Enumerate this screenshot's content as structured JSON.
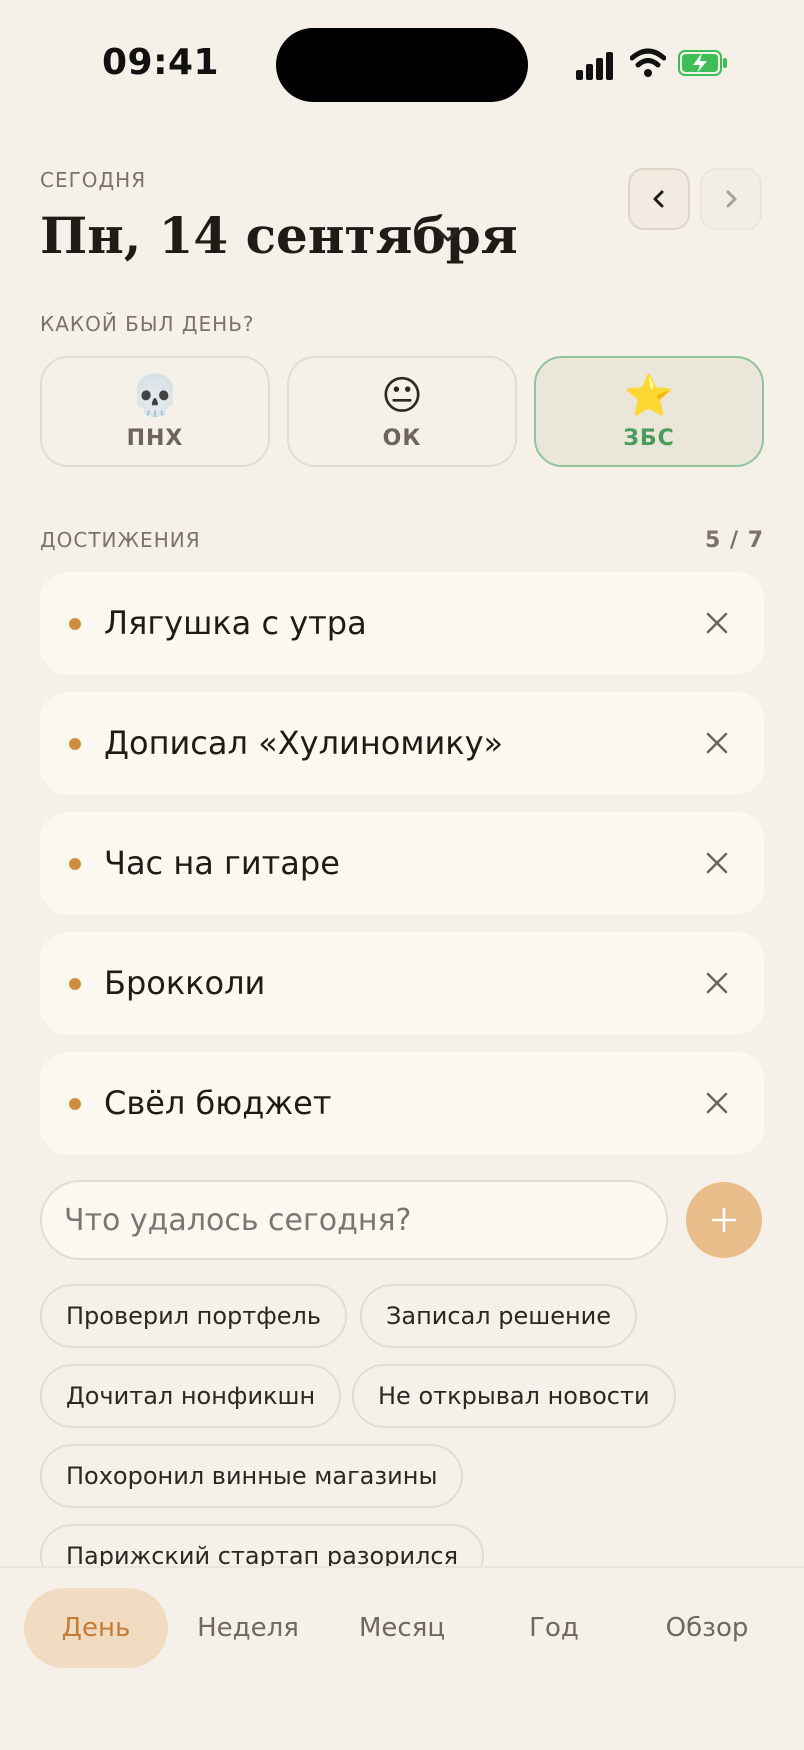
{
  "status": {
    "time": "09:41"
  },
  "header": {
    "today_label": "СЕГОДНЯ",
    "date": "Пн, 14 сентября"
  },
  "mood": {
    "question": "КАКОЙ БЫЛ ДЕНЬ?",
    "options": [
      {
        "emoji": "💀",
        "label": "ПНХ"
      },
      {
        "emoji": "😐",
        "label": "ОК"
      },
      {
        "emoji": "⭐",
        "label": "ЗБС"
      }
    ],
    "selected": "ЗБС",
    "accent": "#4a9c5d"
  },
  "achievements": {
    "label": "ДОСТИЖЕНИЯ",
    "count": "5 / 7",
    "items": [
      "Лягушка с утра",
      "Дописал «Хулиномику»",
      "Час на гитаре",
      "Брокколи",
      "Свёл бюджет"
    ],
    "bullet_color": "#d08f3f"
  },
  "input": {
    "placeholder": "Что удалось сегодня?",
    "value": ""
  },
  "suggestions": [
    "Проверил портфель",
    "Записал решение",
    "Дочитал нонфикшн",
    "Не открывал новости",
    "Похоронил винные магазины",
    "Парижский стартап разорился"
  ],
  "tabs": [
    "День",
    "Неделя",
    "Месяц",
    "Год",
    "Обзор"
  ],
  "active_tab": "День"
}
